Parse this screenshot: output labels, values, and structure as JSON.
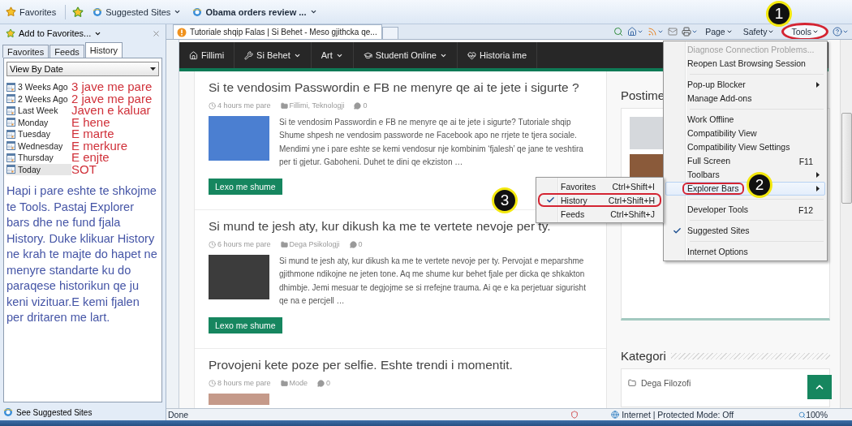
{
  "favorites_bar": {
    "favorites": "Favorites",
    "links": [
      {
        "label": "Suggested Sites",
        "bold": false
      },
      {
        "label": "Obama orders review ...",
        "bold": true
      }
    ]
  },
  "explorer_pane": {
    "add_to_favorites": "Add to Favorites...",
    "tabs": [
      {
        "label": "Favorites",
        "selected": false
      },
      {
        "label": "Feeds",
        "selected": false
      },
      {
        "label": "History",
        "selected": true
      }
    ],
    "view_select": "View By Date",
    "history_items": [
      {
        "label": "3 Weeks Ago",
        "note": "3 jave me pare",
        "selected": false
      },
      {
        "label": "2 Weeks Ago",
        "note": "2 jave me pare",
        "selected": false
      },
      {
        "label": "Last Week",
        "note": "Javen e kaluar",
        "selected": false
      },
      {
        "label": "Monday",
        "note": "E hene",
        "selected": false
      },
      {
        "label": "Tuesday",
        "note": "E marte",
        "selected": false
      },
      {
        "label": "Wednesday",
        "note": "E merkure",
        "selected": false
      },
      {
        "label": "Thursday",
        "note": "E enjte",
        "selected": false
      },
      {
        "label": "Today",
        "note": "SOT",
        "selected": true
      }
    ],
    "instructions": "Hapi i pare eshte te shkojme te Tools. Pastaj Explorer bars dhe ne fund fjala History. Duke klikuar History ne krah te majte do hapet ne menyre standarte ku do paraqese historikun qe ju keni vizituar.E kemi fjalen per dritaren me lart.",
    "footer_link": "See Suggested Sites"
  },
  "browser_tab": {
    "title": "Tutoriale shqip Falas | Si Behet - Meso gjithcka qe..."
  },
  "command_bar": {
    "page": "Page",
    "safety": "Safety",
    "tools": {
      "label": "Tools",
      "circled": true
    }
  },
  "site_nav": [
    {
      "label": "Fillimi",
      "dropdown": false
    },
    {
      "label": "Si Behet",
      "dropdown": true
    },
    {
      "label": "Art",
      "dropdown": true
    },
    {
      "label": "Studenti Online",
      "dropdown": true
    },
    {
      "label": "Historia ime",
      "dropdown": false
    }
  ],
  "posts": [
    {
      "title": "Si te vendosim Passwordin e FB ne menyre qe ai te jete i sigurte ?",
      "time": "4 hours me pare",
      "categories": "Fillimi, Teknologji",
      "comments": "0",
      "excerpt": "Si te vendosim Passwordin e FB ne menyre qe ai te jete i sigurte? Tutoriale shqip Shume shpesh ne vendosim passworde ne Facebook apo ne rrjete te tjera sociale. Mendimi yne i pare eshte se kemi vendosur nje kombinim ‘fjalesh’ qe jane te veshtira per ti gjetur. Gaboheni. Duhet te dini qe ekziston …",
      "button": "Lexo me shume"
    },
    {
      "title": "Si mund te jesh aty, kur dikush ka me te vertete nevoje per ty.",
      "time": "6 hours me pare",
      "categories": "Dega Psikologji",
      "comments": "0",
      "excerpt": "Si mund te jesh aty, kur dikush ka me te vertete nevoje per ty. Pervojat e meparshme gjithmone ndikojne ne jeten tone. Aq me shume kur behet fjale per dicka qe shkakton dhimbje. Jemi mesuar te degjojme se si rrefejne trauma. Ai qe e ka perjetuar sigurisht qe na e percjell …",
      "button": "Lexo me shume"
    },
    {
      "title": "Provojeni kete poze per selfie. Eshte trendi i momentit.",
      "time": "8 hours me pare",
      "categories": "Mode",
      "comments": "0"
    }
  ],
  "sidebar": {
    "recent_heading": "Postime",
    "categories_heading": "Kategori",
    "categories": [
      "Dega Filozofi"
    ]
  },
  "tools_menu": [
    {
      "kind": "item",
      "label": "Diagnose Connection Problems...",
      "disabled": true,
      "selected": false,
      "circled": false
    },
    {
      "kind": "item",
      "label": "Reopen Last Browsing Session",
      "disabled": false,
      "selected": false,
      "circled": false
    },
    {
      "kind": "separator"
    },
    {
      "kind": "submenu",
      "label": "Pop-up Blocker",
      "disabled": false,
      "selected": false,
      "circled": false
    },
    {
      "kind": "item",
      "label": "Manage Add-ons",
      "disabled": false,
      "selected": false,
      "circled": false
    },
    {
      "kind": "separator"
    },
    {
      "kind": "item",
      "label": "Work Offline",
      "disabled": false,
      "selected": false,
      "circled": false
    },
    {
      "kind": "item",
      "label": "Compatibility View",
      "disabled": false,
      "selected": false,
      "circled": false
    },
    {
      "kind": "item",
      "label": "Compatibility View Settings",
      "disabled": false,
      "selected": false,
      "circled": false
    },
    {
      "kind": "item",
      "label": "Full Screen",
      "shortcut": "F11",
      "disabled": false,
      "selected": false,
      "circled": false
    },
    {
      "kind": "submenu",
      "label": "Toolbars",
      "disabled": false,
      "selected": false,
      "circled": false
    },
    {
      "kind": "submenu",
      "label": "Explorer Bars",
      "disabled": false,
      "selected": true,
      "circled": true
    },
    {
      "kind": "separator"
    },
    {
      "kind": "item",
      "label": "Developer Tools",
      "shortcut": "F12",
      "disabled": false,
      "selected": false,
      "circled": false
    },
    {
      "kind": "separator"
    },
    {
      "kind": "check",
      "label": "Suggested Sites",
      "checked": true,
      "disabled": false,
      "selected": false,
      "circled": false
    },
    {
      "kind": "separator"
    },
    {
      "kind": "item",
      "label": "Internet Options",
      "disabled": false,
      "selected": false,
      "circled": false
    }
  ],
  "explorer_bars_submenu": [
    {
      "label": "Favorites",
      "shortcut": "Ctrl+Shift+I",
      "checked": false,
      "circled": false
    },
    {
      "label": "History",
      "shortcut": "Ctrl+Shift+H",
      "checked": true,
      "circled": true
    },
    {
      "label": "Feeds",
      "shortcut": "Ctrl+Shift+J",
      "checked": false,
      "circled": false
    }
  ],
  "callouts": [
    "1",
    "2",
    "3"
  ],
  "status_bar": {
    "text": "Done",
    "zone": "Internet | Protected Mode: Off",
    "zoom": "100%"
  }
}
